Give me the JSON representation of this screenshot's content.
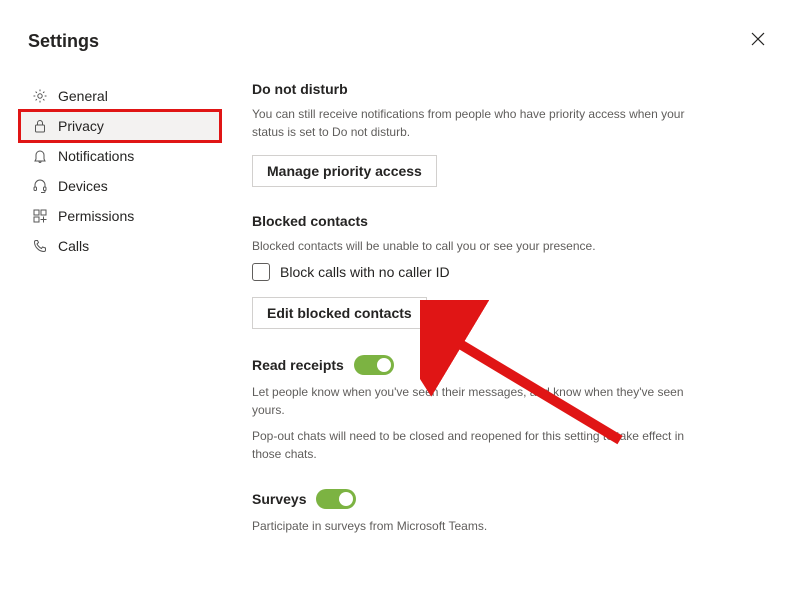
{
  "header": {
    "title": "Settings"
  },
  "sidebar": {
    "items": [
      {
        "label": "General"
      },
      {
        "label": "Privacy"
      },
      {
        "label": "Notifications"
      },
      {
        "label": "Devices"
      },
      {
        "label": "Permissions"
      },
      {
        "label": "Calls"
      }
    ]
  },
  "content": {
    "dnd": {
      "title": "Do not disturb",
      "desc": "You can still receive notifications from people who have priority access when your status is set to Do not disturb.",
      "button": "Manage priority access"
    },
    "blocked": {
      "title": "Blocked contacts",
      "desc": "Blocked contacts will be unable to call you or see your presence.",
      "checkbox_label": "Block calls with no caller ID",
      "button": "Edit blocked contacts"
    },
    "read": {
      "title": "Read receipts",
      "desc1": "Let people know when you've seen their messages, and know when they've seen yours.",
      "desc2": "Pop-out chats will need to be closed and reopened for this setting to take effect in those chats."
    },
    "surveys": {
      "title": "Surveys",
      "desc": "Participate in surveys from Microsoft Teams."
    }
  }
}
